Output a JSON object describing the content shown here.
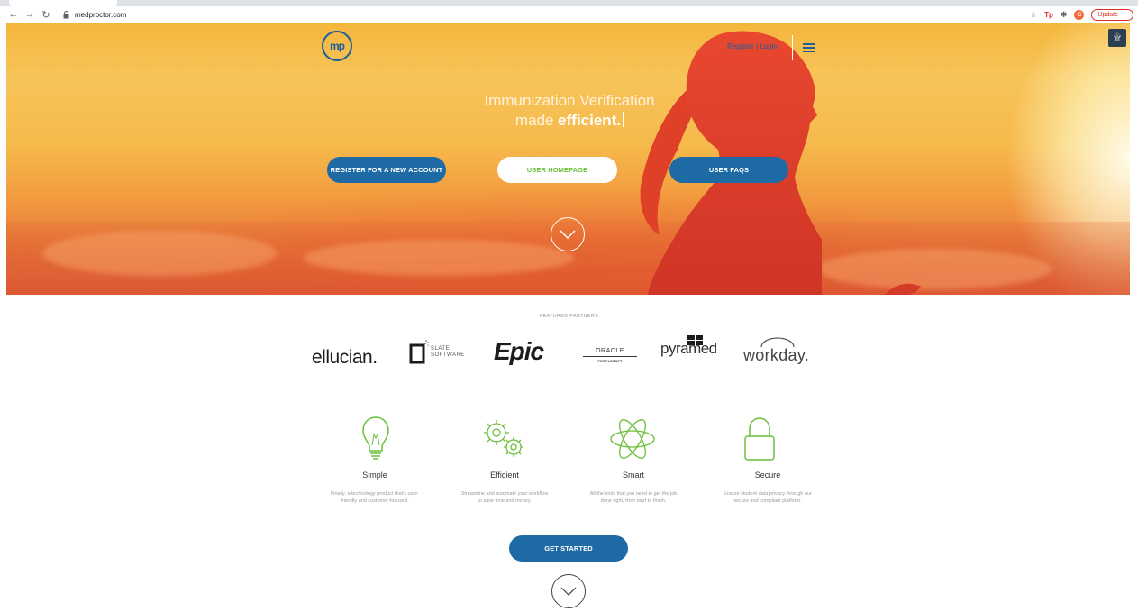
{
  "browser": {
    "url": "medproctor.com",
    "update_label": "Update",
    "avatar_initial": "G",
    "ext_tp": "Tp"
  },
  "header": {
    "logo_text": "mp",
    "register_login": "Register | Login"
  },
  "hero": {
    "title_line1": "Immunization Verification",
    "title_line2_prefix": "made ",
    "title_line2_bold": "efficient.",
    "buttons": [
      {
        "label": "REGISTER FOR A NEW ACCOUNT"
      },
      {
        "label": "USER HOMEPAGE"
      },
      {
        "label": "USER FAQS"
      }
    ]
  },
  "partners": {
    "label": "FEATURED PARTNERS",
    "items": [
      {
        "name": "ellucian."
      },
      {
        "name_line1": "SLATE",
        "name_line2": "SOFTWARE"
      },
      {
        "name": "Epic"
      },
      {
        "name_line1": "ORACLE",
        "name_line2": "PEOPLESOFT"
      },
      {
        "name": "pyramed"
      },
      {
        "name": "workday."
      }
    ]
  },
  "features": [
    {
      "title": "Simple",
      "desc_line1": "Finally, a technology product that's user-",
      "desc_line2": "friendly and customer-focused.",
      "icon": "lightbulb-icon"
    },
    {
      "title": "Efficient",
      "desc_line1": "Streamline and automate your workflow",
      "desc_line2": "to save time and money.",
      "icon": "gears-icon"
    },
    {
      "title": "Smart",
      "desc_line1": "All the tools that you need to get the job",
      "desc_line2": "done right, from start to finish.",
      "icon": "atom-icon"
    },
    {
      "title": "Secure",
      "desc_line1": "Ensure student data privacy through our",
      "desc_line2": "secure and compliant platform.",
      "icon": "padlock-icon"
    }
  ],
  "cta": {
    "label": "GET STARTED"
  },
  "colors": {
    "brand_blue": "#1d6aa5",
    "accent_green": "#6bbf3a"
  }
}
